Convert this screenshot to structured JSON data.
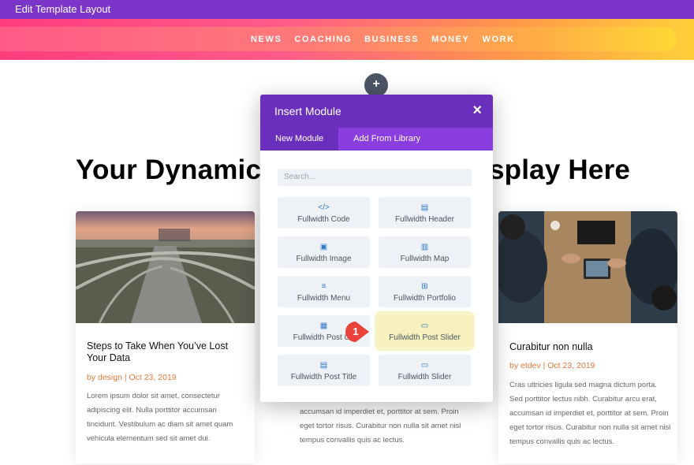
{
  "topbar": {
    "title": "Edit Template Layout"
  },
  "nav": {
    "items": [
      "NEWS",
      "COACHING",
      "BUSINESS",
      "MONEY",
      "WORK"
    ]
  },
  "add_button": {
    "label": "+"
  },
  "page": {
    "heading_left": "Your Dynamic",
    "heading_right": "splay Here"
  },
  "modal": {
    "title": "Insert Module",
    "close_label": "×",
    "tabs": [
      {
        "label": "New Module",
        "active": true
      },
      {
        "label": "Add From Library",
        "active": false
      }
    ],
    "search_placeholder": "Search...",
    "modules": [
      {
        "label": "Fullwidth Code",
        "icon": "code-icon"
      },
      {
        "label": "Fullwidth Header",
        "icon": "header-icon"
      },
      {
        "label": "Fullwidth Image",
        "icon": "image-icon"
      },
      {
        "label": "Fullwidth Map",
        "icon": "map-icon"
      },
      {
        "label": "Fullwidth Menu",
        "icon": "menu-icon"
      },
      {
        "label": "Fullwidth Portfolio",
        "icon": "portfolio-icon"
      },
      {
        "label": "Fullwidth Post Co",
        "icon": "post-content-icon"
      },
      {
        "label": "Fullwidth Post Slider",
        "icon": "post-slider-icon",
        "highlighted": true
      },
      {
        "label": "Fullwidth Post Title",
        "icon": "post-title-icon"
      },
      {
        "label": "Fullwidth Slider",
        "icon": "slider-icon"
      }
    ],
    "highlight_color": "#f7f1bd"
  },
  "step_badge": {
    "number": "1",
    "color": "#e8423a"
  },
  "cards": {
    "left": {
      "title": "Steps to Take When You’ve Lost Your Data",
      "meta": "by design | Oct 23, 2019",
      "excerpt": "Lorem ipsum dolor sit amet, consectetur adipiscing elit. Nulla porttitor accumsan tincidunt. Vestibulum ac diam sit amet quam vehicula elementum sed sit amet dui."
    },
    "mid": {
      "excerpt": "accumsan id imperdiet et, porttitor at sem. Proin eget tortor risus. Curabitur non nulla sit amet nisl tempus convallis quis ac lectus."
    },
    "right": {
      "title": "Curabitur non nulla",
      "meta": "by etdev | Oct 23, 2019",
      "excerpt": "Cras ultricies ligula sed magna dictum porta. Sed porttitor lectus nibh. Curabitur arcu erat, accumsan id imperdiet et, porttitor at sem. Proin eget tortor risus. Curabitur non nulla sit amet nisl tempus convallis quis ac lectus."
    }
  },
  "colors": {
    "topbar": "#7b35c9",
    "modal_header": "#6b2fbd",
    "tabs": "#8a3ee0",
    "meta": "#e07a3b",
    "icon": "#2e78c8"
  }
}
